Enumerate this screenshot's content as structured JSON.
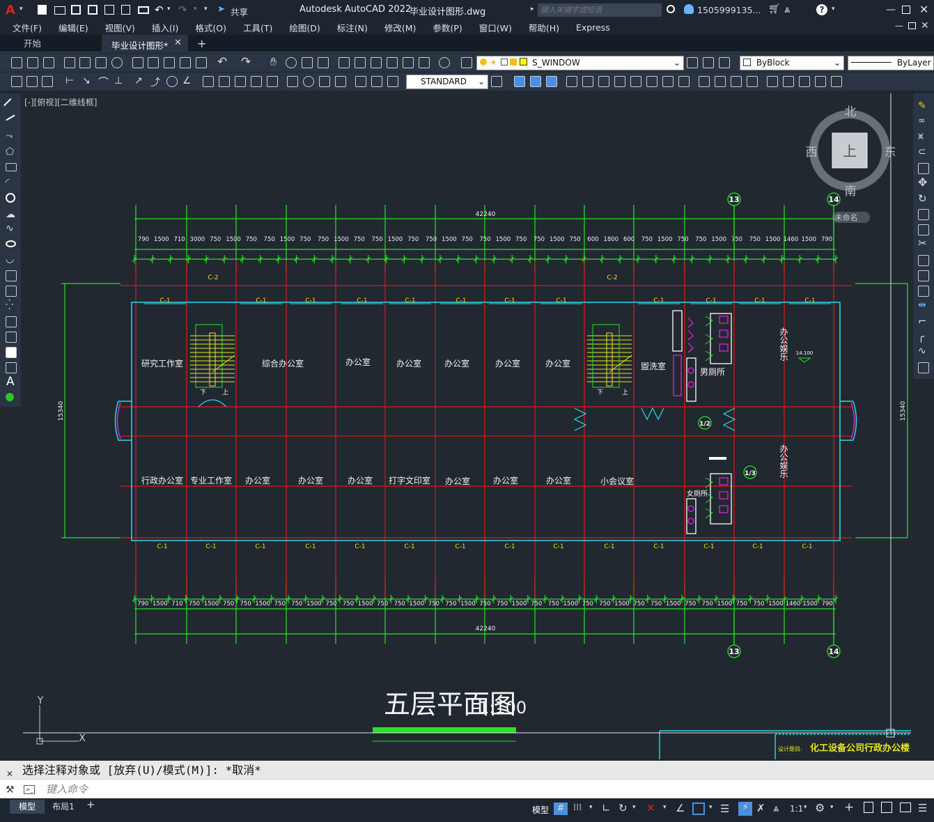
{
  "app": {
    "title": "Autodesk AutoCAD 2022",
    "file_name": "毕业设计图形.dwg",
    "search_placeholder": "键入关键字或短语",
    "user": "1505999135...",
    "share_label": "共享"
  },
  "menu": [
    "文件(F)",
    "编辑(E)",
    "视图(V)",
    "插入(I)",
    "格式(O)",
    "工具(T)",
    "绘图(D)",
    "标注(N)",
    "修改(M)",
    "参数(P)",
    "窗口(W)",
    "帮助(H)",
    "Express"
  ],
  "tabs": [
    {
      "label": "开始"
    },
    {
      "label": "毕业设计图形*"
    }
  ],
  "toolbar": {
    "layer": "S_WINDOW",
    "color": "ByBlock",
    "linetype": "ByLayer",
    "textstyle": "STANDARD"
  },
  "viewport": {
    "label": "[-][俯视][二维线框]",
    "viewcube": {
      "north": "北",
      "south": "南",
      "east": "东",
      "west": "西",
      "top": "上",
      "wcs": "未命名"
    }
  },
  "drawing": {
    "title": "五层平面图",
    "scale": "1:100",
    "overall_dim": "42240",
    "side_dim": "15340",
    "top_dims": [
      "790",
      "1500",
      "710",
      "3000",
      "750",
      "1500",
      "750",
      "750",
      "1500",
      "750",
      "750",
      "1500",
      "750",
      "750",
      "1500",
      "750",
      "750",
      "1500",
      "750",
      "750",
      "1500",
      "750",
      "750",
      "1500",
      "750",
      "600",
      "1800",
      "600",
      "750",
      "1500",
      "750",
      "750",
      "1500",
      "750",
      "750",
      "1500",
      "1460",
      "1500",
      "790"
    ],
    "bottom_dims": [
      "790",
      "1500",
      "710",
      "750",
      "1500",
      "750",
      "750",
      "1500",
      "750",
      "750",
      "1500",
      "750",
      "750",
      "1500",
      "750",
      "750",
      "1500",
      "750",
      "750",
      "1500",
      "750",
      "750",
      "1500",
      "750",
      "750",
      "1500",
      "750",
      "750",
      "1500",
      "750",
      "750",
      "1500",
      "750",
      "750",
      "1500",
      "750",
      "750",
      "1500",
      "1460",
      "1500",
      "790"
    ],
    "axis_labels": [
      "13",
      "14",
      "1/2",
      "1/3"
    ],
    "window_labels": [
      "C-1",
      "C-2"
    ],
    "rooms_top": [
      "研究工作室",
      "综合办公室",
      "办公室",
      "办公室",
      "办公室",
      "办公室",
      "办公室",
      "盥洗室",
      "男厕所"
    ],
    "rooms_bottom": [
      "行政办公室",
      "专业工作室",
      "办公室",
      "办公室",
      "办公室",
      "打字文印室",
      "办公室",
      "办公室",
      "办公室",
      "小会议室",
      "女厕所"
    ],
    "room_vertical": [
      "办公娱乐",
      "办公娱乐"
    ],
    "level": "14.100",
    "stair_down": "下",
    "stair_up": "上",
    "titleblock_label": "设计题目:",
    "titleblock_project": "化工设备公司行政办公楼"
  },
  "command": {
    "history": "选择注释对象或 [放弃(U)/模式(M)]: *取消*",
    "placeholder": "键入命令"
  },
  "status": {
    "model_tab": "模型",
    "layout_tab": "布局1",
    "model_btn": "模型",
    "scale": "1:1"
  },
  "colors": {
    "dim_green": "#28e228",
    "axis_red": "#e01818",
    "wall_cyan": "#30d8e8",
    "fixture_magenta": "#e020e0",
    "stair_yellow": "#e8e820",
    "bg": "#212830"
  }
}
